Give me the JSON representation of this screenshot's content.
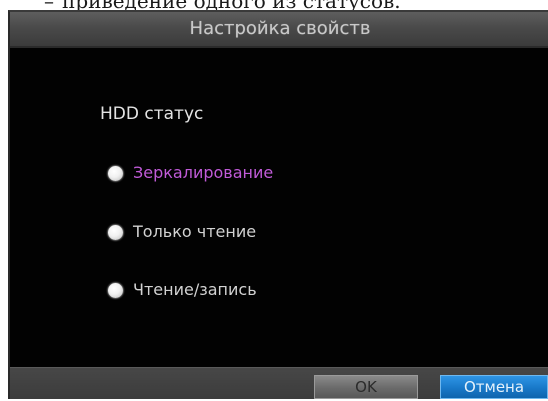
{
  "caption": {
    "bullet": "–",
    "text": "приведение одного из статусов."
  },
  "dialog": {
    "title": "Настройка свойств",
    "group_label": "HDD статус",
    "options": [
      {
        "label": "Зеркалирование",
        "selected": true
      },
      {
        "label": "Только чтение",
        "selected": false
      },
      {
        "label": "Чтение/запись",
        "selected": false
      }
    ],
    "buttons": {
      "ok_label": "OK",
      "cancel_label": "Отмена"
    }
  },
  "colors": {
    "dialog_background": "#020202",
    "title_bar": "#4a4a4a",
    "highlight_text": "#c05bd8",
    "cancel_button": "#1878c8",
    "ok_button": "#6a6a6a"
  }
}
